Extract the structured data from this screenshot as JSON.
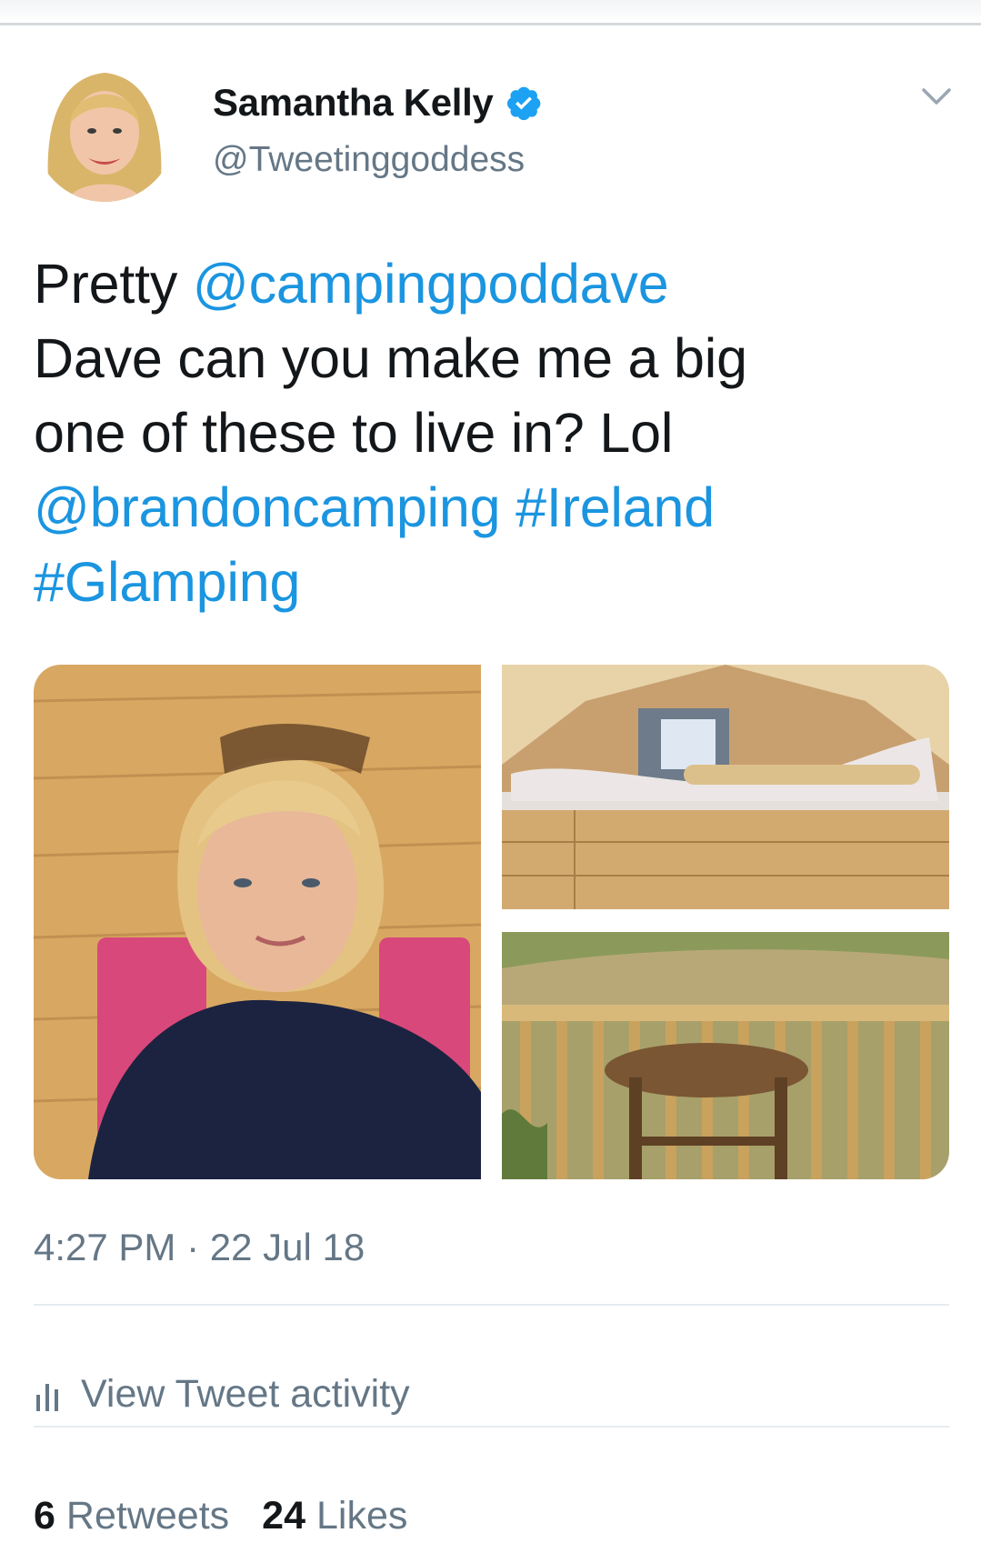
{
  "author": {
    "name": "Samantha Kelly",
    "handle": "@Tweetinggoddess",
    "verified_icon": "verified-badge-icon"
  },
  "tweet": {
    "segments": [
      {
        "text": "Pretty ",
        "link": false
      },
      {
        "text": "@campingpoddave",
        "link": true
      },
      {
        "text": "\nDave can you make me a big\none of these to live in? Lol\n",
        "link": false
      },
      {
        "text": "@brandoncamping",
        "link": true
      },
      {
        "text": " ",
        "link": false
      },
      {
        "text": "#Ireland",
        "link": true
      },
      {
        "text": "\n",
        "link": false
      },
      {
        "text": "#Glamping",
        "link": true
      }
    ],
    "time": "4:27 PM",
    "separator": "·",
    "date": "22 Jul 18"
  },
  "activity": {
    "label": "View Tweet activity",
    "icon": "bar-chart-icon"
  },
  "stats": {
    "retweets_count": "6",
    "retweets_label": "Retweets",
    "likes_count": "24",
    "likes_label": "Likes"
  },
  "colors": {
    "link": "#1b95e0",
    "text": "#14171a",
    "secondary": "#657786",
    "divider": "#e6ecf0",
    "verified": "#1da1f2"
  }
}
